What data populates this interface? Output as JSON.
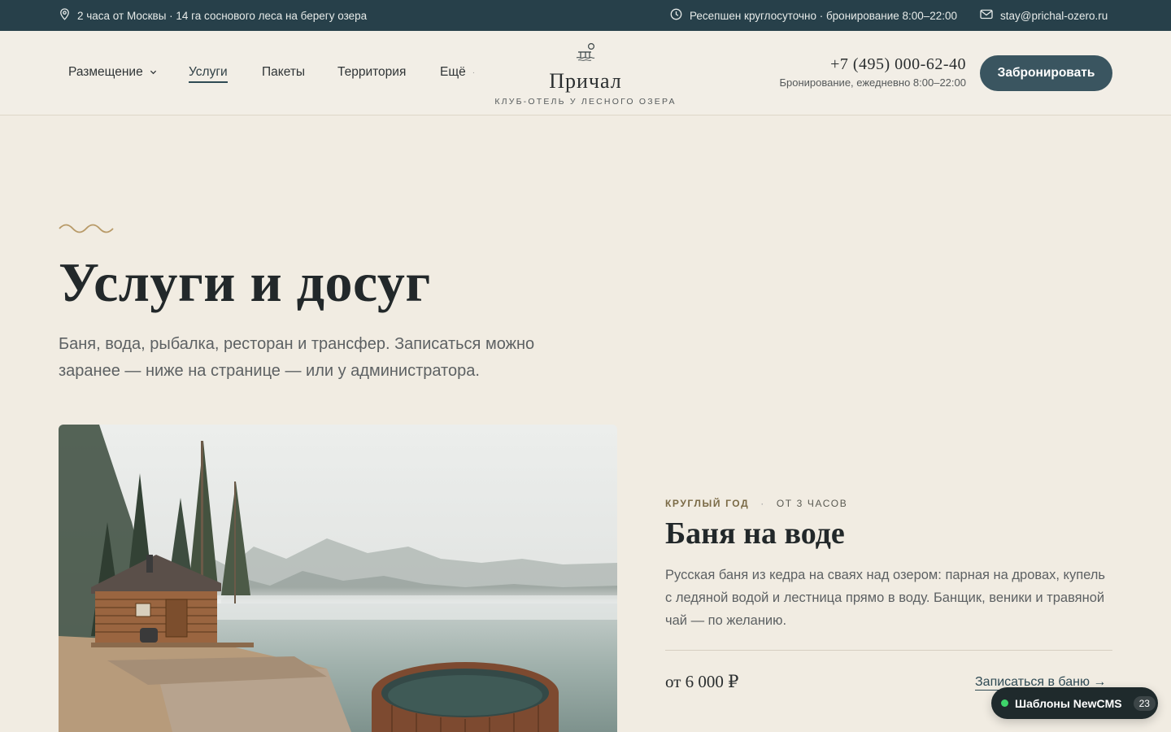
{
  "topbar": {
    "location": "2 часа от Москвы · 14 га соснового леса на берегу озера",
    "hours": "Ресепшен круглосуточно · бронирование 8:00–22:00",
    "email": "stay@prichal-ozero.ru"
  },
  "nav": {
    "items": [
      {
        "label": "Размещение",
        "has_dropdown": true
      },
      {
        "label": "Услуги",
        "active": true
      },
      {
        "label": "Пакеты"
      },
      {
        "label": "Территория"
      },
      {
        "label": "Ещё",
        "has_dropdown": true
      }
    ]
  },
  "logo": {
    "name": "Причал",
    "subtitle": "КЛУБ-ОТЕЛЬ У ЛЕСНОГО ОЗЕРА"
  },
  "contact": {
    "phone": "+7 (495) 000-62-40",
    "note": "Бронирование, ежедневно 8:00–22:00",
    "book_label": "Забронировать"
  },
  "hero": {
    "title": "Услуги и досуг",
    "lead": "Баня, вода, рыбалка, ресторан и трансфер. Записаться можно заранее — ниже на странице — или у администратора."
  },
  "service": {
    "season": "КРУГЛЫЙ ГОД",
    "duration": "ОТ 3 ЧАСОВ",
    "title": "Баня на воде",
    "description": "Русская баня из кедра на сваях над озером: парная на дровах, купель с ледяной водой и лестница прямо в воду. Банщик, веники и травяной чай — по желанию.",
    "price": "от 6 000 ₽",
    "cta": "Записаться в баню →"
  },
  "badge": {
    "label": "Шаблоны NewCMS",
    "count": "23"
  },
  "colors": {
    "topbar": "#27404a",
    "background": "#f1ece2",
    "accent": "#3a5560",
    "wave": "#b89a68"
  }
}
